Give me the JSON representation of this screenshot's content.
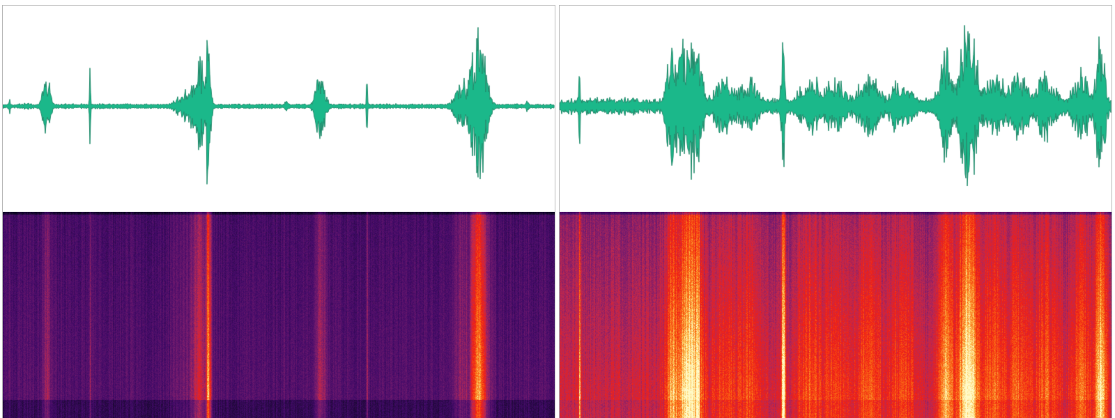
{
  "theme": {
    "waveform_fill": "#1bb88a",
    "waveform_stroke": "#1f8a6a",
    "spectrogram_palette": "inferno",
    "panel_border": "#b8b8b8"
  },
  "panels": [
    {
      "id": "left",
      "activity": "sparse",
      "noise_level": 0.03,
      "events": [
        {
          "t": 0.012,
          "amp": 0.09,
          "width": 0.002
        },
        {
          "t": 0.043,
          "amp": 0.05,
          "width": 0.008
        },
        {
          "t": 0.079,
          "amp": 0.38,
          "width": 0.006
        },
        {
          "t": 0.158,
          "amp": 0.4,
          "width": 0.001
        },
        {
          "t": 0.225,
          "amp": 0.04,
          "width": 0.003
        },
        {
          "t": 0.33,
          "amp": 0.18,
          "width": 0.016
        },
        {
          "t": 0.355,
          "amp": 0.55,
          "width": 0.012
        },
        {
          "t": 0.372,
          "amp": 0.98,
          "width": 0.004
        },
        {
          "t": 0.44,
          "amp": 0.04,
          "width": 0.004
        },
        {
          "t": 0.513,
          "amp": 0.06,
          "width": 0.004
        },
        {
          "t": 0.575,
          "amp": 0.4,
          "width": 0.008
        },
        {
          "t": 0.66,
          "amp": 0.4,
          "width": 0.001
        },
        {
          "t": 0.835,
          "amp": 0.3,
          "width": 0.014
        },
        {
          "t": 0.862,
          "amp": 0.95,
          "width": 0.012
        },
        {
          "t": 0.95,
          "amp": 0.06,
          "width": 0.003
        }
      ]
    },
    {
      "id": "right",
      "activity": "dense",
      "noise_level": 0.1,
      "events": [
        {
          "t": 0.036,
          "amp": 0.8,
          "width": 0.001
        },
        {
          "t": 0.205,
          "amp": 0.7,
          "width": 0.01
        },
        {
          "t": 0.235,
          "amp": 0.9,
          "width": 0.018
        },
        {
          "t": 0.25,
          "amp": 0.98,
          "width": 0.004
        },
        {
          "t": 0.3,
          "amp": 0.35,
          "width": 0.02
        },
        {
          "t": 0.34,
          "amp": 0.35,
          "width": 0.02
        },
        {
          "t": 0.405,
          "amp": 0.95,
          "width": 0.003
        },
        {
          "t": 0.455,
          "amp": 0.4,
          "width": 0.02
        },
        {
          "t": 0.5,
          "amp": 0.35,
          "width": 0.02
        },
        {
          "t": 0.56,
          "amp": 0.4,
          "width": 0.02
        },
        {
          "t": 0.62,
          "amp": 0.35,
          "width": 0.02
        },
        {
          "t": 0.7,
          "amp": 0.7,
          "width": 0.012
        },
        {
          "t": 0.74,
          "amp": 0.98,
          "width": 0.015
        },
        {
          "t": 0.785,
          "amp": 0.45,
          "width": 0.02
        },
        {
          "t": 0.83,
          "amp": 0.4,
          "width": 0.02
        },
        {
          "t": 0.88,
          "amp": 0.4,
          "width": 0.02
        },
        {
          "t": 0.945,
          "amp": 0.45,
          "width": 0.015
        },
        {
          "t": 0.98,
          "amp": 0.85,
          "width": 0.008
        }
      ]
    }
  ]
}
